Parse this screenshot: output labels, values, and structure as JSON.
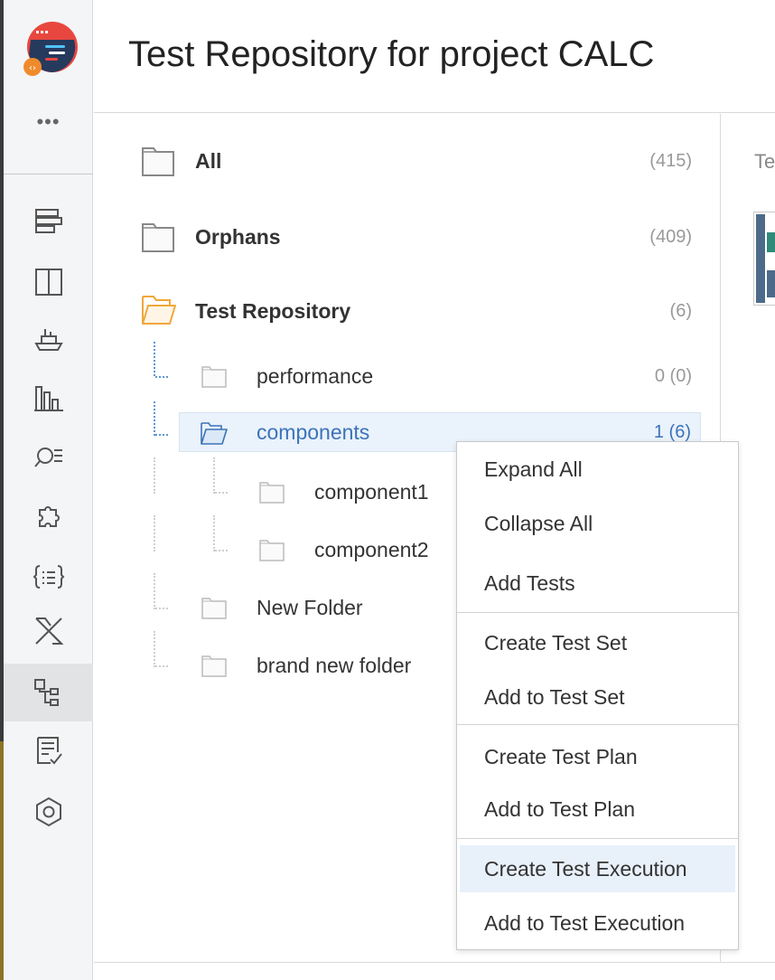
{
  "header": {
    "title": "Test Repository for project CALC"
  },
  "sidebar": {
    "more_label": "•••",
    "items": [
      {
        "icon": "backlog-icon"
      },
      {
        "icon": "board-icon"
      },
      {
        "icon": "releases-icon"
      },
      {
        "icon": "reports-icon"
      },
      {
        "icon": "issues-search-icon"
      },
      {
        "icon": "components-icon"
      },
      {
        "icon": "code-icon"
      },
      {
        "icon": "xray-icon"
      },
      {
        "icon": "test-repository-icon",
        "active": true
      },
      {
        "icon": "test-plans-icon"
      },
      {
        "icon": "settings-icon"
      }
    ]
  },
  "tree": {
    "all": {
      "label": "All",
      "count": "(415)"
    },
    "orphans": {
      "label": "Orphans",
      "count": "(409)"
    },
    "repository": {
      "label": "Test Repository",
      "count": "(6)"
    },
    "performance": {
      "label": "performance",
      "count": "0 (0)"
    },
    "components": {
      "label": "components",
      "count": "1 (6)"
    },
    "component1": {
      "label": "component1"
    },
    "component2": {
      "label": "component2"
    },
    "new_folder": {
      "label": "New Folder"
    },
    "brand_new_folder": {
      "label": "brand new folder"
    }
  },
  "right_panel": {
    "text": "Te"
  },
  "context_menu": {
    "items": [
      "Expand All",
      "Collapse All",
      "Add Tests",
      "Create Test Set",
      "Add to Test Set",
      "Create Test Plan",
      "Add to Test Plan",
      "Create Test Execution",
      "Add to Test Execution"
    ],
    "hovered_index": 7
  },
  "colors": {
    "selected_text": "#3b73b9",
    "selected_bg": "#eaf2fb",
    "open_folder": "#f0a73a",
    "logo_red": "#e8473f",
    "logo_navy": "#263a5e",
    "logo_orange": "#f08b2c"
  }
}
